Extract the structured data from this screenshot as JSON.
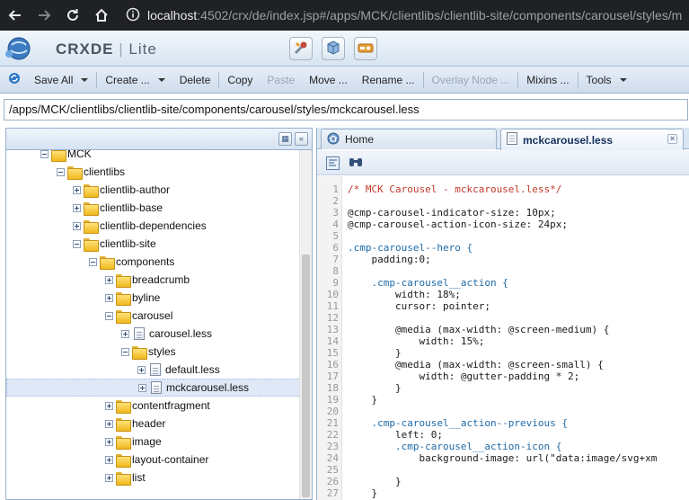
{
  "browser": {
    "url_host": "localhost",
    "url_rest": ":4502/crx/de/index.jsp#/apps/MCK/clientlibs/clientlib-site/components/carousel/styles/m"
  },
  "app": {
    "brand_main": "CRXDE",
    "brand_sep": "|",
    "brand_sub": "Lite"
  },
  "toolbar": {
    "save_all": "Save All",
    "create": "Create ...",
    "delete": "Delete",
    "copy": "Copy",
    "paste": "Paste",
    "move": "Move ...",
    "rename": "Rename ...",
    "overlay_node": "Overlay Node ...",
    "mixins": "Mixins ...",
    "tools": "Tools"
  },
  "path": "/apps/MCK/clientlibs/clientlib-site/components/carousel/styles/mckcarousel.less",
  "tree": [
    {
      "label": "MCK",
      "type": "folder",
      "state": "open"
    },
    {
      "label": "clientlibs",
      "type": "folder",
      "state": "open"
    },
    {
      "label": "clientlib-author",
      "type": "folder",
      "state": "closed"
    },
    {
      "label": "clientlib-base",
      "type": "folder",
      "state": "closed"
    },
    {
      "label": "clientlib-dependencies",
      "type": "folder",
      "state": "closed"
    },
    {
      "label": "clientlib-site",
      "type": "folder",
      "state": "open"
    },
    {
      "label": "components",
      "type": "folder",
      "state": "open"
    },
    {
      "label": "breadcrumb",
      "type": "folder",
      "state": "closed"
    },
    {
      "label": "byline",
      "type": "folder",
      "state": "closed"
    },
    {
      "label": "carousel",
      "type": "folder",
      "state": "open"
    },
    {
      "label": "carousel.less",
      "type": "file",
      "state": "closed"
    },
    {
      "label": "styles",
      "type": "folder",
      "state": "open"
    },
    {
      "label": "default.less",
      "type": "file",
      "state": "closed"
    },
    {
      "label": "mckcarousel.less",
      "type": "file",
      "state": "closed",
      "selected": true
    },
    {
      "label": "contentfragment",
      "type": "folder",
      "state": "closed"
    },
    {
      "label": "header",
      "type": "folder",
      "state": "closed"
    },
    {
      "label": "image",
      "type": "folder",
      "state": "closed"
    },
    {
      "label": "layout-container",
      "type": "folder",
      "state": "closed"
    },
    {
      "label": "list",
      "type": "folder",
      "state": "closed"
    }
  ],
  "tabs": [
    {
      "label": "Home",
      "icon": "home-icon",
      "active": false
    },
    {
      "label": "mckcarousel.less",
      "icon": "file-icon",
      "active": true
    }
  ],
  "code": [
    {
      "n": "1",
      "text": "/* MCK Carousel - mckcarousel.less*/",
      "kind": "comment"
    },
    {
      "n": "2",
      "text": "",
      "kind": "plain"
    },
    {
      "n": "3",
      "text": "@cmp-carousel-indicator-size: 10px;",
      "kind": "plain"
    },
    {
      "n": "4",
      "text": "@cmp-carousel-action-icon-size: 24px;",
      "kind": "plain"
    },
    {
      "n": "5",
      "text": "",
      "kind": "plain"
    },
    {
      "n": "6",
      "text": ".cmp-carousel--hero {",
      "kind": "selector"
    },
    {
      "n": "7",
      "text": "    padding:0;",
      "kind": "plain"
    },
    {
      "n": "8",
      "text": "",
      "kind": "plain"
    },
    {
      "n": "9",
      "text": "    .cmp-carousel__action {",
      "kind": "selector"
    },
    {
      "n": "10",
      "text": "        width: 18%;",
      "kind": "plain"
    },
    {
      "n": "11",
      "text": "        cursor: pointer;",
      "kind": "plain"
    },
    {
      "n": "12",
      "text": "",
      "kind": "plain"
    },
    {
      "n": "13",
      "text": "        @media (max-width: @screen-medium) {",
      "kind": "plain"
    },
    {
      "n": "14",
      "text": "            width: 15%;",
      "kind": "plain"
    },
    {
      "n": "15",
      "text": "        }",
      "kind": "plain"
    },
    {
      "n": "16",
      "text": "        @media (max-width: @screen-small) {",
      "kind": "plain"
    },
    {
      "n": "17",
      "text": "            width: @gutter-padding * 2;",
      "kind": "plain"
    },
    {
      "n": "18",
      "text": "        }",
      "kind": "plain"
    },
    {
      "n": "19",
      "text": "    }",
      "kind": "plain"
    },
    {
      "n": "20",
      "text": "",
      "kind": "plain"
    },
    {
      "n": "21",
      "text": "    .cmp-carousel__action--previous {",
      "kind": "selector"
    },
    {
      "n": "22",
      "text": "        left: 0;",
      "kind": "plain"
    },
    {
      "n": "23",
      "text": "        .cmp-carousel__action-icon {",
      "kind": "selector"
    },
    {
      "n": "24",
      "text": "            background-image: url(\"data:image/svg+xm",
      "kind": "plain"
    },
    {
      "n": "25",
      "text": "",
      "kind": "plain"
    },
    {
      "n": "26",
      "text": "        }",
      "kind": "plain"
    },
    {
      "n": "27",
      "text": "    }",
      "kind": "plain"
    }
  ]
}
